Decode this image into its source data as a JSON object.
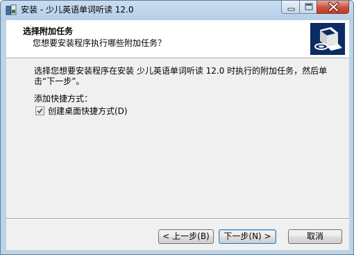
{
  "window": {
    "title": "安装 - 少儿英语单词听读 12.0",
    "controls": {
      "minimize_icon": "minimize-icon",
      "maximize_icon": "maximize-icon",
      "close_icon": "close-icon"
    }
  },
  "header": {
    "title": "选择附加任务",
    "subtitle": "您想要安装程序执行哪些附加任务？"
  },
  "body": {
    "description": "选择您想要安装程序在安装 少儿英语单词听读 12.0 时执行的附加任务，然后单击“下一步”。",
    "shortcut_group_label": "添加快捷方式：",
    "desktop_shortcut": {
      "label": "创建桌面快捷方式(D)",
      "checked": true
    }
  },
  "buttons": {
    "back": "< 上一步(B)",
    "next": "下一步(N) >",
    "cancel": "取消"
  },
  "colors": {
    "frame": "#bcd3ea",
    "client": "#f0f0f0",
    "wizard_image_bg": "#0b2b63",
    "close_button": "#c9513c"
  }
}
